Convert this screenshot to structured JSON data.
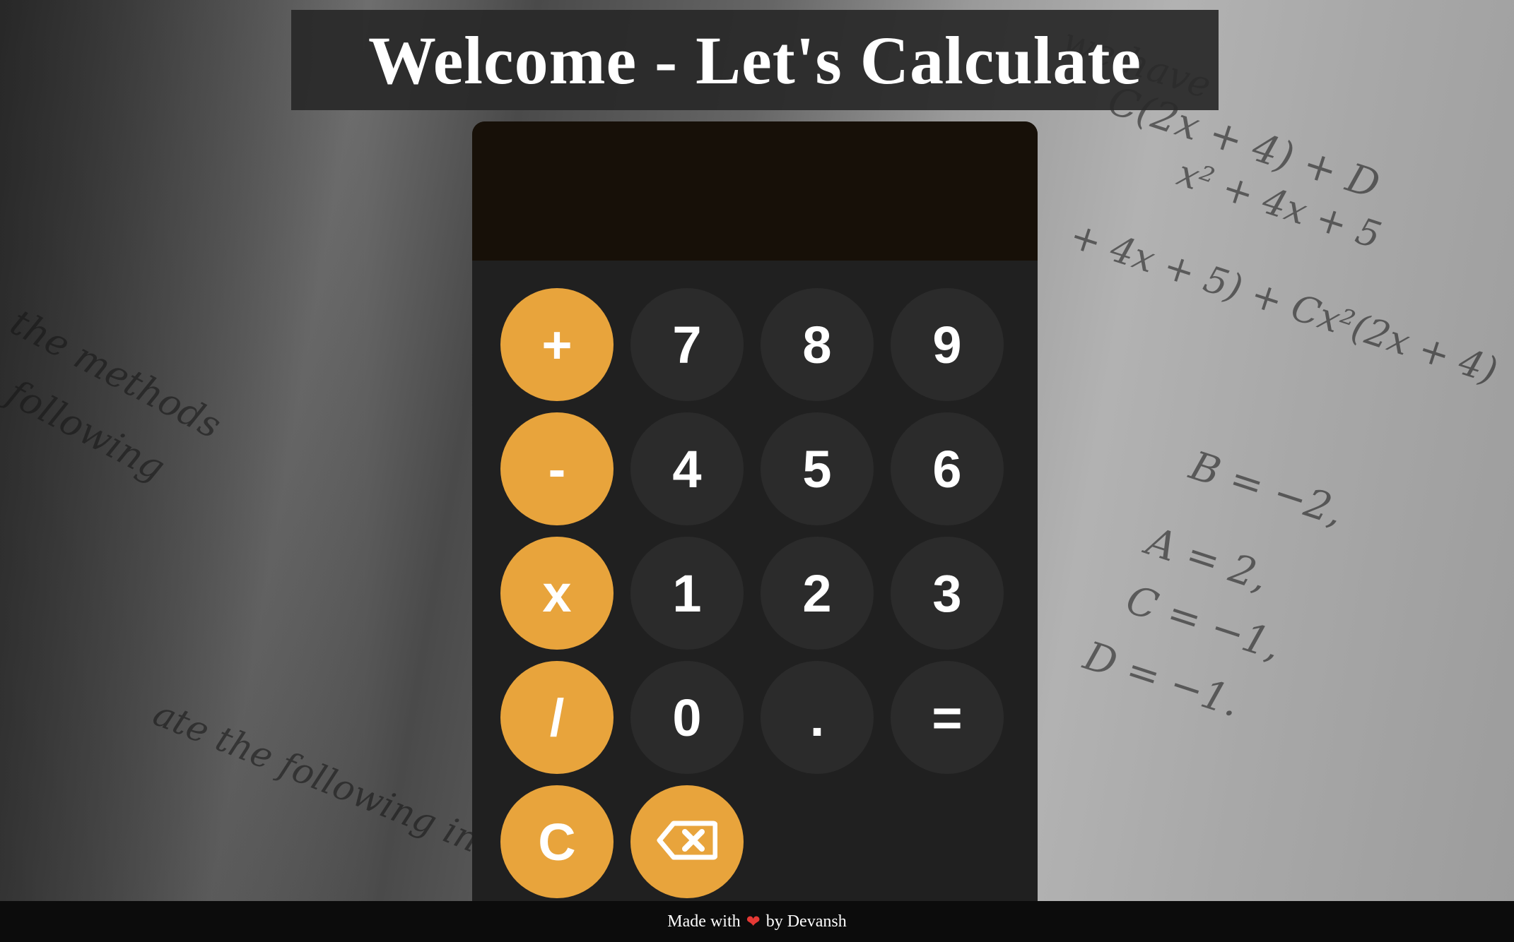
{
  "header": {
    "title": "Welcome - Let's Calculate"
  },
  "display": {
    "value": ""
  },
  "keys": {
    "plus": "+",
    "seven": "7",
    "eight": "8",
    "nine": "9",
    "minus": "-",
    "four": "4",
    "five": "5",
    "six": "6",
    "multiply": "x",
    "one": "1",
    "two": "2",
    "three": "3",
    "divide": "/",
    "zero": "0",
    "decimal": ".",
    "equals": "=",
    "clear": "C",
    "backspace_icon": "backspace-icon"
  },
  "footer": {
    "made_with": "Made with",
    "heart_icon": "heart-icon",
    "by": "by Devansh"
  },
  "colors": {
    "operator": "#e8a43c",
    "number": "#2b2b2b",
    "panel": "#202020",
    "display": "#171008"
  }
}
